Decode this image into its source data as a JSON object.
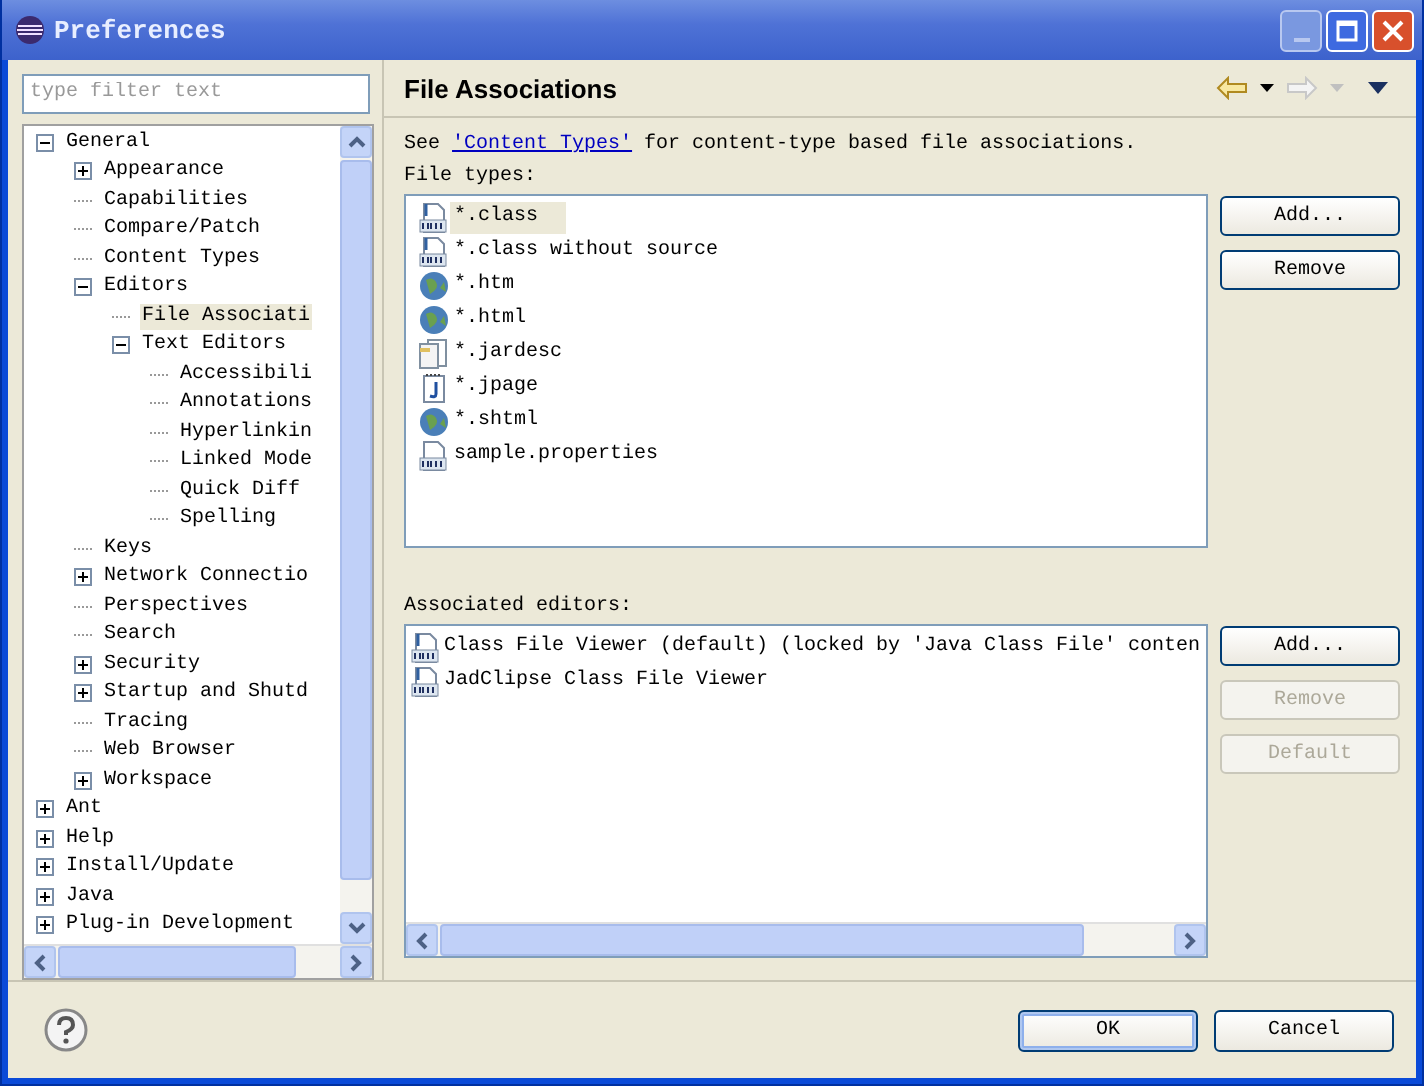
{
  "window": {
    "title": "Preferences"
  },
  "filter": {
    "placeholder": "type filter text"
  },
  "tree": [
    {
      "label": "General",
      "expanded": true,
      "selected": false,
      "children": [
        {
          "label": "Appearance",
          "expanded": false,
          "selected": false
        },
        {
          "label": "Capabilities",
          "selected": false
        },
        {
          "label": "Compare/Patch",
          "selected": false
        },
        {
          "label": "Content Types",
          "selected": false
        },
        {
          "label": "Editors",
          "expanded": true,
          "selected": false,
          "children": [
            {
              "label": "File Associati",
              "selected": true
            },
            {
              "label": "Text Editors",
              "expanded": true,
              "selected": false,
              "children": [
                {
                  "label": "Accessibili",
                  "selected": false
                },
                {
                  "label": "Annotations",
                  "selected": false
                },
                {
                  "label": "Hyperlinkin",
                  "selected": false
                },
                {
                  "label": "Linked Mode",
                  "selected": false
                },
                {
                  "label": "Quick Diff",
                  "selected": false
                },
                {
                  "label": "Spelling",
                  "selected": false
                }
              ]
            }
          ]
        },
        {
          "label": "Keys",
          "selected": false
        },
        {
          "label": "Network Connectio",
          "expanded": false,
          "selected": false
        },
        {
          "label": "Perspectives",
          "selected": false
        },
        {
          "label": "Search",
          "selected": false
        },
        {
          "label": "Security",
          "expanded": false,
          "selected": false
        },
        {
          "label": "Startup and Shutd",
          "expanded": false,
          "selected": false
        },
        {
          "label": "Tracing",
          "selected": false
        },
        {
          "label": "Web Browser",
          "selected": false
        },
        {
          "label": "Workspace",
          "expanded": false,
          "selected": false
        }
      ]
    },
    {
      "label": "Ant",
      "expanded": false,
      "selected": false
    },
    {
      "label": "Help",
      "expanded": false,
      "selected": false
    },
    {
      "label": "Install/Update",
      "expanded": false,
      "selected": false
    },
    {
      "label": "Java",
      "expanded": false,
      "selected": false
    },
    {
      "label": "Plug-in Development",
      "expanded": false,
      "selected": false
    }
  ],
  "page": {
    "title": "File Associations",
    "intro": {
      "before": "See ",
      "link": "'Content Types'",
      "after": " for content-type based file associations."
    },
    "file_types_label": "File types:",
    "file_types": [
      {
        "kind": "class",
        "label": "*.class",
        "selected": true
      },
      {
        "kind": "class",
        "label": "*.class without source",
        "selected": false
      },
      {
        "kind": "web",
        "label": "*.htm",
        "selected": false
      },
      {
        "kind": "web",
        "label": "*.html",
        "selected": false
      },
      {
        "kind": "jar",
        "label": "*.jardesc",
        "selected": false
      },
      {
        "kind": "jpage",
        "label": "*.jpage",
        "selected": false
      },
      {
        "kind": "web",
        "label": "*.shtml",
        "selected": false
      },
      {
        "kind": "properties",
        "label": "sample.properties",
        "selected": false
      }
    ],
    "file_type_buttons": [
      {
        "label": "Add...",
        "disabled": false
      },
      {
        "label": "Remove",
        "disabled": false
      }
    ],
    "editors_label": "Associated editors:",
    "editors": [
      {
        "label": "Class File Viewer (default) (locked by 'Java Class File' conten"
      },
      {
        "label": "JadClipse Class File Viewer"
      }
    ],
    "editor_buttons": [
      {
        "label": "Add...",
        "disabled": false
      },
      {
        "label": "Remove",
        "disabled": true
      },
      {
        "label": "Default",
        "disabled": true
      }
    ]
  },
  "buttons": [
    {
      "label": "OK",
      "default": true
    },
    {
      "label": "Cancel",
      "default": false
    }
  ]
}
